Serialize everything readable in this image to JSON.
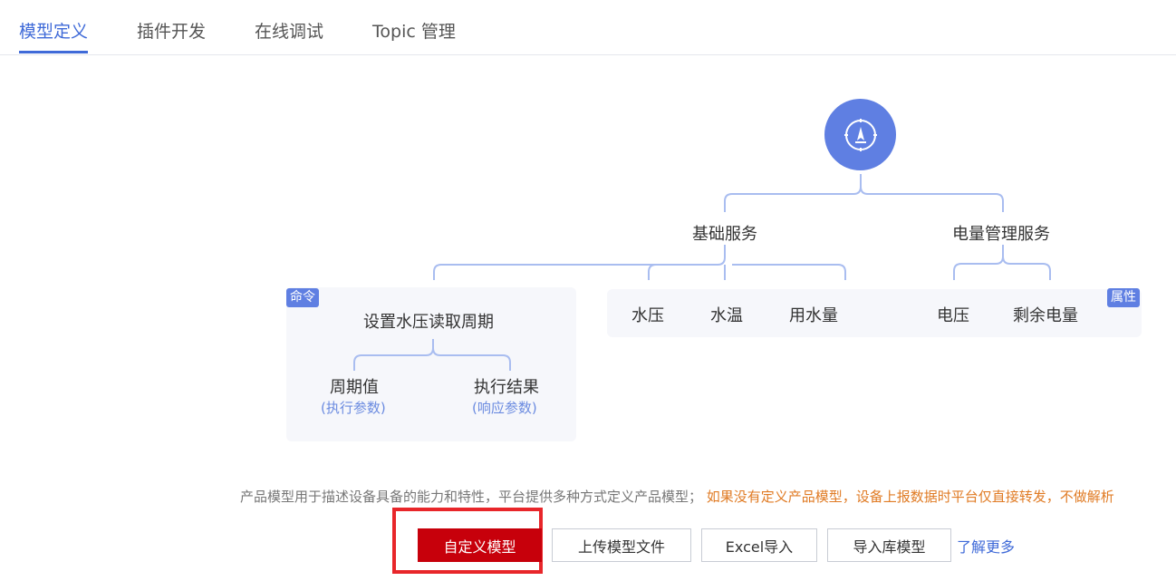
{
  "tabs": [
    {
      "label": "模型定义",
      "active": true
    },
    {
      "label": "插件开发",
      "active": false
    },
    {
      "label": "在线调试",
      "active": false
    },
    {
      "label": "Topic 管理",
      "active": false
    }
  ],
  "diagram": {
    "root_icon": "compass-icon",
    "services": [
      {
        "name": "基础服务"
      },
      {
        "name": "电量管理服务"
      }
    ],
    "command_tag": "命令",
    "property_tag": "属性",
    "command": {
      "name": "设置水压读取周期",
      "params": [
        {
          "name": "周期值",
          "type": "(执行参数)"
        },
        {
          "name": "执行结果",
          "type": "(响应参数)"
        }
      ]
    },
    "basic_properties": [
      "水压",
      "水温",
      "用水量"
    ],
    "power_properties": [
      "电压",
      "剩余电量"
    ]
  },
  "description": {
    "text": "产品模型用于描述设备具备的能力和特性，平台提供多种方式定义产品模型；",
    "warning": "如果没有定义产品模型，设备上报数据时平台仅直接转发，不做解析"
  },
  "actions": {
    "custom_model": "自定义模型",
    "upload_model_file": "上传模型文件",
    "excel_import": "Excel导入",
    "import_library_model": "导入库模型",
    "learn_more": "了解更多"
  },
  "colors": {
    "accent": "#3f6ad8",
    "primary_button": "#c7000b",
    "highlight_box": "#e8262a",
    "node_circle": "#5f7fe2",
    "warning_text": "#e07b24"
  }
}
